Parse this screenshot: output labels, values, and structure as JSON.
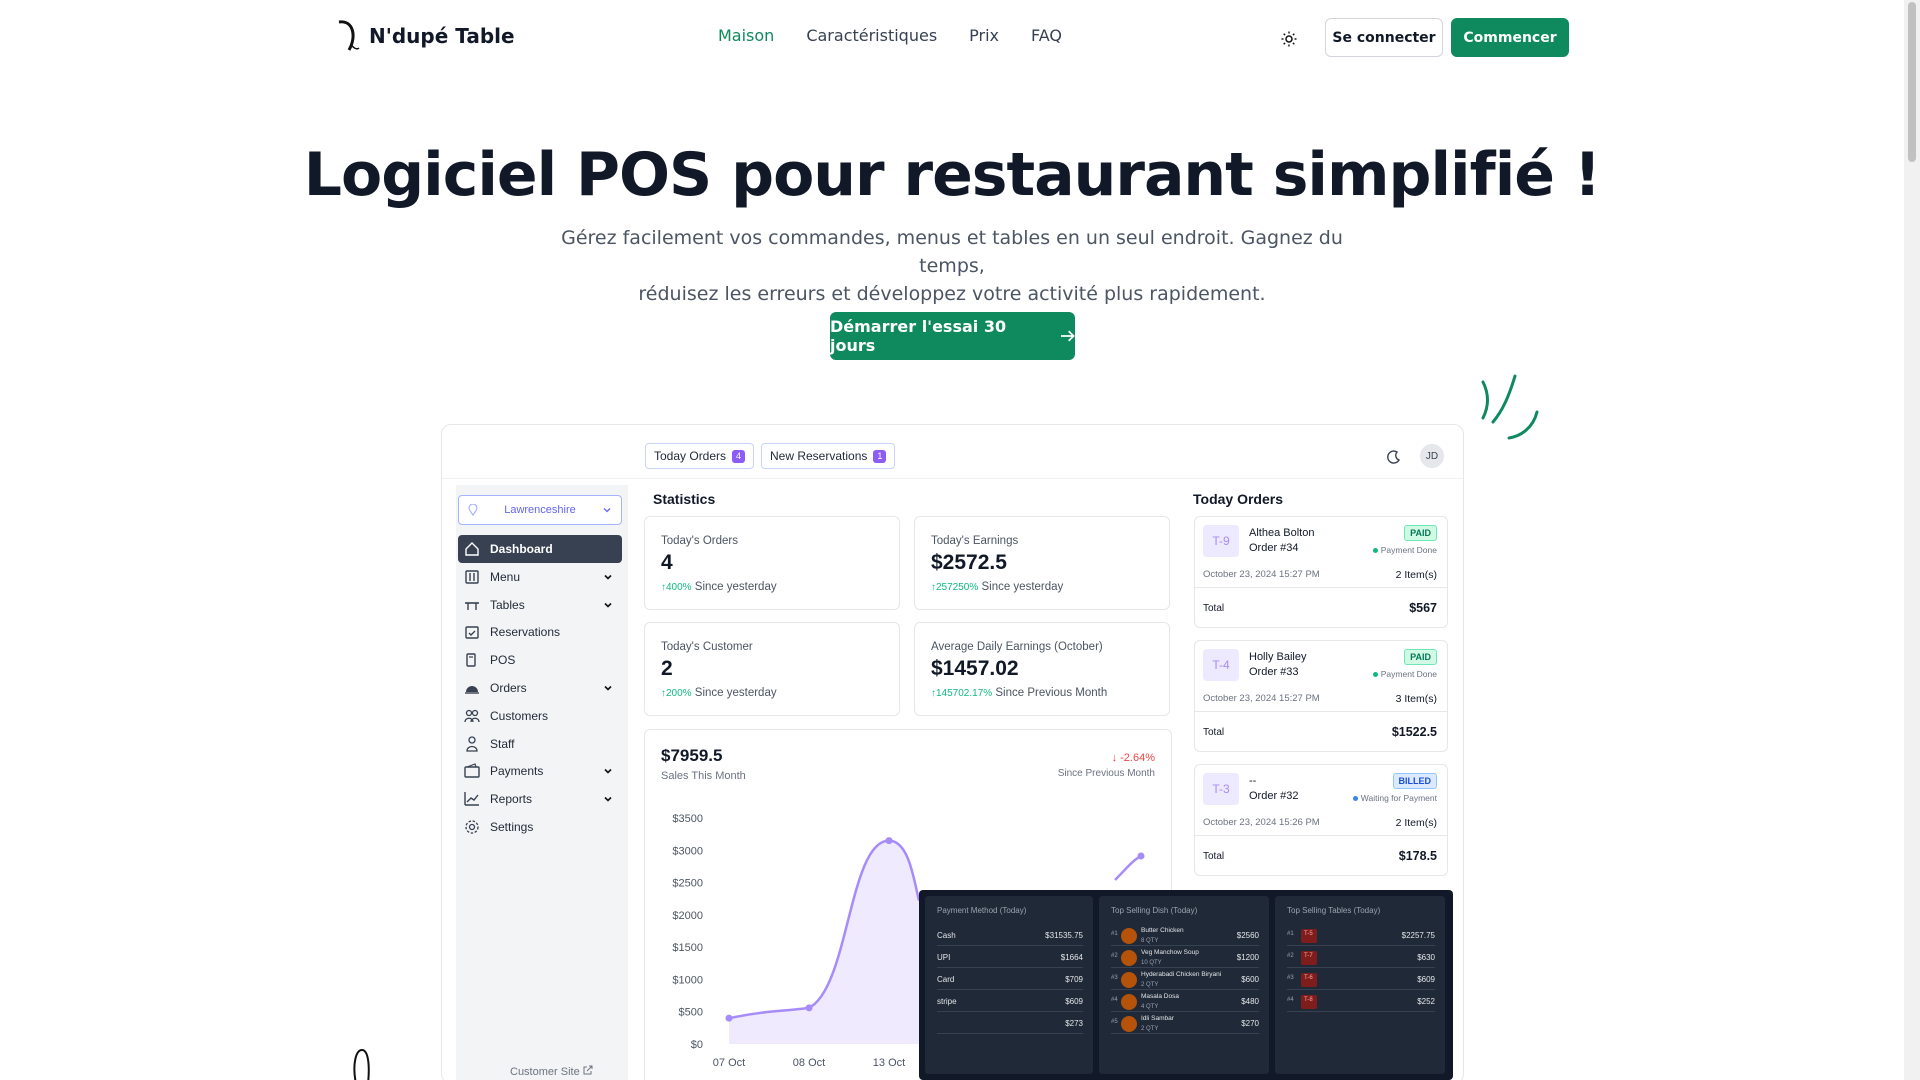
{
  "nav": {
    "brand": "N'dupé Table",
    "links": [
      "Maison",
      "Caractéristiques",
      "Prix",
      "FAQ"
    ],
    "login": "Se connecter",
    "start": "Commencer"
  },
  "hero": {
    "title": "Logiciel POS pour restaurant simplifié !",
    "subtitle_line1": "Gérez facilement vos commandes, menus et tables en un seul endroit. Gagnez du temps,",
    "subtitle_line2": "réduisez les erreurs et développez votre activité plus rapidement.",
    "cta": "Démarrer l'essai 30 jours"
  },
  "colors": {
    "accent": "#0f8a5f",
    "chart": "#a78bfa"
  },
  "dashboard": {
    "chips": [
      {
        "label": "Today Orders",
        "count": "4"
      },
      {
        "label": "New Reservations",
        "count": "1"
      }
    ],
    "avatar": "JD",
    "location": "Lawrenceshire",
    "sidebar": [
      {
        "label": "Dashboard",
        "icon": "home-icon",
        "active": true
      },
      {
        "label": "Menu",
        "icon": "menu-icon",
        "chevron": true
      },
      {
        "label": "Tables",
        "icon": "table-icon",
        "chevron": true
      },
      {
        "label": "Reservations",
        "icon": "calendar-check-icon"
      },
      {
        "label": "POS",
        "icon": "pos-icon"
      },
      {
        "label": "Orders",
        "icon": "cloche-icon",
        "chevron": true
      },
      {
        "label": "Customers",
        "icon": "users-icon"
      },
      {
        "label": "Staff",
        "icon": "staff-icon"
      },
      {
        "label": "Payments",
        "icon": "wallet-icon",
        "chevron": true
      },
      {
        "label": "Reports",
        "icon": "chart-line-icon",
        "chevron": true
      },
      {
        "label": "Settings",
        "icon": "gear-icon"
      }
    ],
    "customer_site": "Customer Site",
    "statistics_title": "Statistics",
    "stats": [
      {
        "label": "Today's Orders",
        "value": "4",
        "change": "400%",
        "since": "Since yesterday"
      },
      {
        "label": "Today's Earnings",
        "value": "$2572.5",
        "change": "257250%",
        "since": "Since yesterday"
      },
      {
        "label": "Today's Customer",
        "value": "2",
        "change": "200%",
        "since": "Since yesterday"
      },
      {
        "label": "Average Daily Earnings (October)",
        "value": "$1457.02",
        "change": "145702.17%",
        "since": "Since Previous Month"
      }
    ],
    "sales": {
      "amount": "$7959.5",
      "label": "Sales This Month",
      "change": "-2.64%",
      "since": "Since Previous Month"
    },
    "today_orders_title": "Today Orders",
    "orders": [
      {
        "table": "T-9",
        "customer": "Althea Bolton",
        "order": "Order #34",
        "status": "PAID",
        "payment": "Payment Done",
        "date": "October 23, 2024 15:27 PM",
        "items": "2 Item(s)",
        "total_label": "Total",
        "total": "$567"
      },
      {
        "table": "T-4",
        "customer": "Holly Bailey",
        "order": "Order #33",
        "status": "PAID",
        "payment": "Payment Done",
        "date": "October 23, 2024 15:27 PM",
        "items": "3 Item(s)",
        "total_label": "Total",
        "total": "$1522.5"
      },
      {
        "table": "T-3",
        "customer": "--",
        "order": "Order #32",
        "status": "BILLED",
        "payment": "Waiting for Payment",
        "date": "October 23, 2024 15:26 PM",
        "items": "2 Item(s)",
        "total_label": "Total",
        "total": "$178.5"
      }
    ],
    "payment_methods": {
      "title": "Payment Method (Today)",
      "rows": [
        {
          "label": "Cash",
          "value": "$31535.75"
        },
        {
          "label": "UPI",
          "value": "$1664"
        },
        {
          "label": "Card",
          "value": "$709"
        },
        {
          "label": "stripe",
          "value": "$609"
        },
        {
          "label": "",
          "value": "$273"
        }
      ]
    },
    "top_dishes": {
      "title": "Top Selling Dish (Today)",
      "rows": [
        {
          "rank": "#1",
          "name": "Butter Chicken",
          "qty": "8 QTY",
          "value": "$2560"
        },
        {
          "rank": "#2",
          "name": "Veg Manchow Soup",
          "qty": "10 QTY",
          "value": "$1200"
        },
        {
          "rank": "#3",
          "name": "Hyderabadi Chicken Biryani",
          "qty": "2 QTY",
          "value": "$600"
        },
        {
          "rank": "#4",
          "name": "Masala Dosa",
          "qty": "4 QTY",
          "value": "$480"
        },
        {
          "rank": "#5",
          "name": "Idli Sambar",
          "qty": "2 QTY",
          "value": "$270"
        }
      ]
    },
    "top_tables": {
      "title": "Top Selling Tables (Today)",
      "rows": [
        {
          "rank": "#1",
          "table": "T-5",
          "value": "$2257.75"
        },
        {
          "rank": "#2",
          "table": "T-7",
          "value": "$630"
        },
        {
          "rank": "#3",
          "table": "T-6",
          "value": "$609"
        },
        {
          "rank": "#4",
          "table": "T-8",
          "value": "$252"
        }
      ]
    }
  },
  "chart_data": {
    "type": "area",
    "title": "",
    "x": [
      "07 Oct",
      "08 Oct",
      "13 Oct"
    ],
    "ytick_labels": [
      "$3500",
      "$3000",
      "$2500",
      "$2000",
      "$1500",
      "$1000",
      "$500",
      "$0"
    ],
    "ylim": [
      0,
      3500
    ],
    "series": [
      {
        "values": [
          400,
          560,
          3150
        ]
      }
    ]
  }
}
